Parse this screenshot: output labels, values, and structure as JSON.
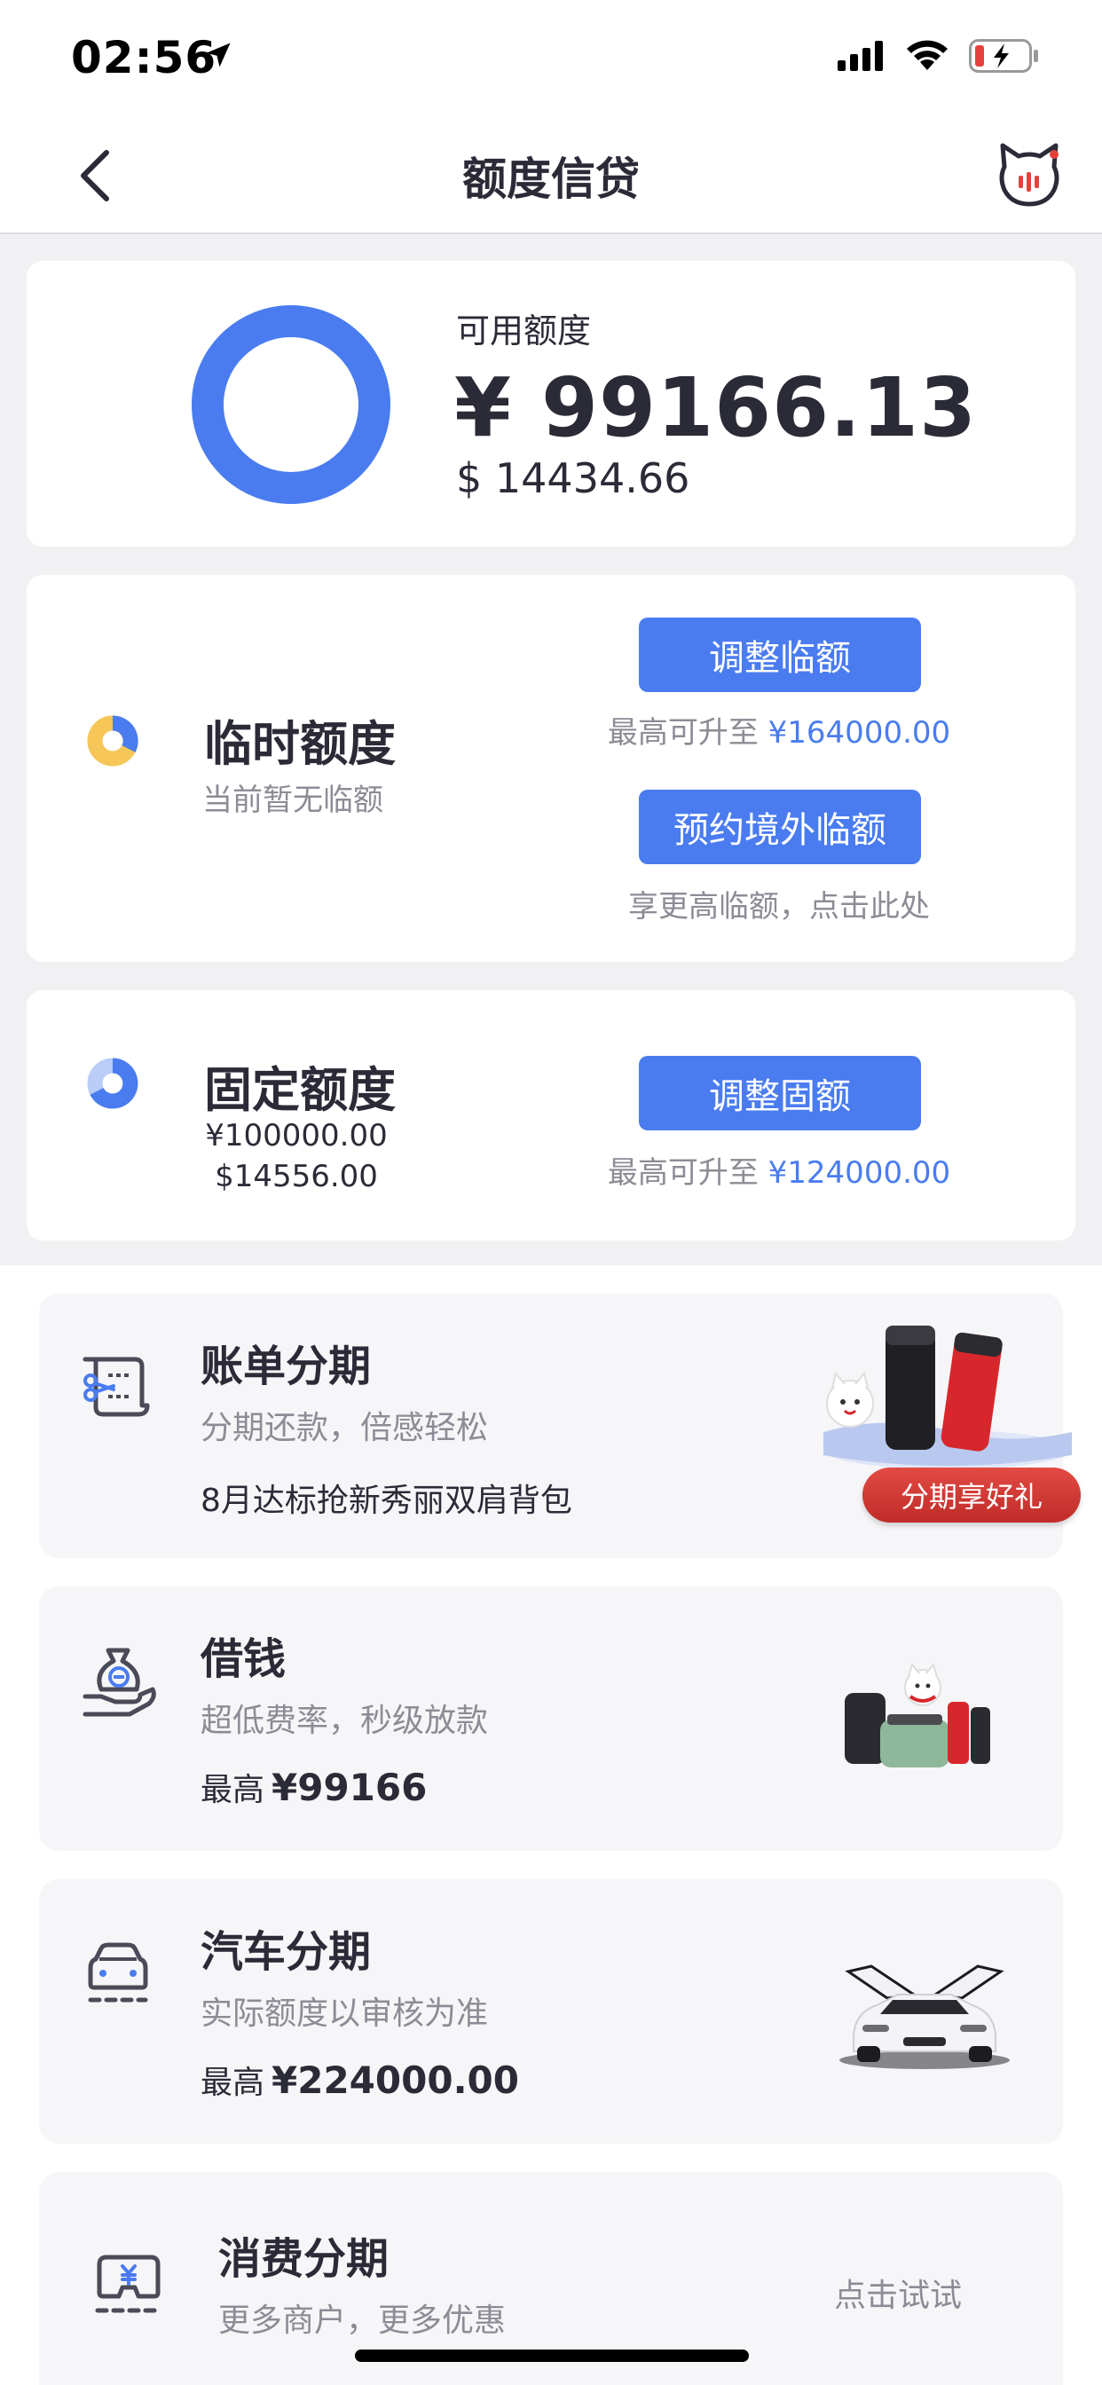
{
  "status_bar": {
    "time": "02:56"
  },
  "nav": {
    "title": "额度信贷"
  },
  "available": {
    "label": "可用额度",
    "cny": "¥ 99166.13",
    "usd": "$ 14434.66"
  },
  "temp_quota": {
    "title": "临时额度",
    "subtitle": "当前暂无临额",
    "adjust_button": "调整临额",
    "adjust_hint_prefix": "最高可升至",
    "adjust_hint_amount": "¥164000.00",
    "overseas_button": "预约境外临额",
    "overseas_hint": "享更高临额，点击此处"
  },
  "fixed_quota": {
    "title": "固定额度",
    "cny": "¥100000.00",
    "usd": "$14556.00",
    "adjust_button": "调整固额",
    "hint_prefix": "最高可升至",
    "hint_amount": "¥124000.00"
  },
  "products": [
    {
      "title": "账单分期",
      "subtitle": "分期还款，倍感轻松",
      "note": "8月达标抢新秀丽双肩背包",
      "badge": "分期享好礼"
    },
    {
      "title": "借钱",
      "subtitle": "超低费率，秒级放款",
      "max_prefix": "最高",
      "max_amount": "¥99166"
    },
    {
      "title": "汽车分期",
      "subtitle": "实际额度以审核为准",
      "max_prefix": "最高",
      "max_amount": "¥224000.00"
    },
    {
      "title": "消费分期",
      "subtitle": "更多商户，更多优惠",
      "action": "点击试试"
    }
  ],
  "colors": {
    "accent": "#4a7cf0",
    "badge_red": "#d23a35",
    "text": "#2b2b38",
    "muted": "#8c8c96"
  },
  "icons": [
    "location-arrow-icon",
    "signal-icon",
    "wifi-icon",
    "battery-charging-icon",
    "back-chevron-icon",
    "cat-service-icon",
    "bill-scissors-icon",
    "money-bag-hand-icon",
    "car-icon",
    "yuan-box-icon"
  ]
}
